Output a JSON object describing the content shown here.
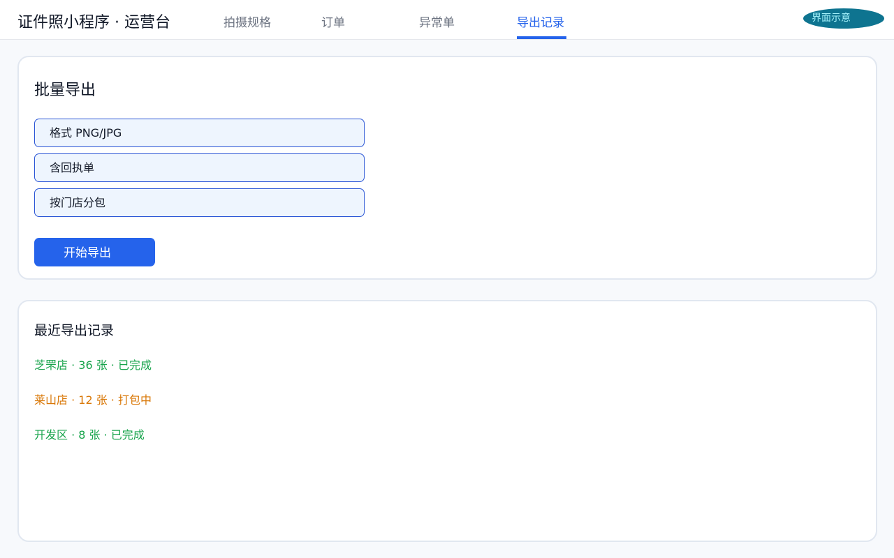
{
  "header": {
    "app_title": "证件照小程序 · 运营台",
    "tabs": [
      {
        "label": "拍摄规格",
        "active": false
      },
      {
        "label": "订单",
        "active": false
      },
      {
        "label": "异常单",
        "active": false
      },
      {
        "label": "导出记录",
        "active": true
      }
    ],
    "demo_badge": "界面示意"
  },
  "batch_export": {
    "title": "批量导出",
    "options": [
      {
        "label": "格式 PNG/JPG"
      },
      {
        "label": "含回执单"
      },
      {
        "label": "按门店分包"
      }
    ],
    "start_button": "开始导出"
  },
  "recent_exports": {
    "title": "最近导出记录",
    "items": [
      {
        "text": "芝罘店 · 36 张 · 已完成",
        "status": "done",
        "color": "#16a34a"
      },
      {
        "text": "莱山店 · 12 张 · 打包中",
        "status": "packing",
        "color": "#d97706"
      },
      {
        "text": "开发区 · 8 张 · 已完成",
        "status": "done",
        "color": "#16a34a"
      }
    ]
  },
  "colors": {
    "accent": "#2563eb",
    "success": "#16a34a",
    "warning": "#d97706",
    "badge": "#0e7490"
  }
}
